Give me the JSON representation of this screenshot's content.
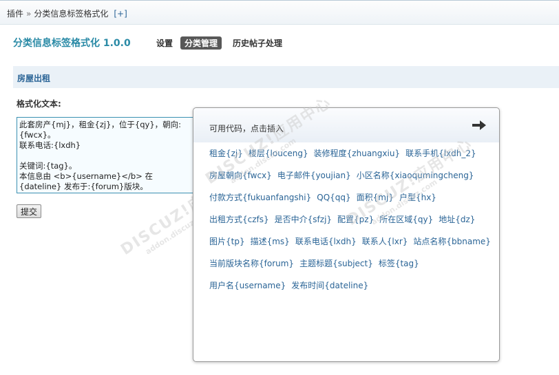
{
  "breadcrumb": {
    "root": "插件",
    "separator": "»",
    "current": "分类信息标签格式化",
    "add_label": "[+]"
  },
  "plugin_title": "分类信息标签格式化 1.0.0",
  "tabs": [
    {
      "label": "设置",
      "active": false
    },
    {
      "label": "分类管理",
      "active": true
    },
    {
      "label": "历史帖子处理",
      "active": false
    }
  ],
  "section_title": "房屋出租",
  "format_label": "格式化文本:",
  "format_text": "此套房产{mj}，租金{zj}，位于{qy}，朝向:{fwcx}。\n联系电话:{lxdh}\n\n关键词:{tag}。\n本信息由 <b>{username}</b> 在{dateline} 发布于:{forum}版块。",
  "submit_label": "提交",
  "popup": {
    "title": "可用代码，点击插入",
    "close_icon": "arrow-right-icon",
    "rows": [
      [
        "租金{zj}",
        "楼层{louceng}",
        "装修程度{zhuangxiu}",
        "联系手机{lxdh_2}"
      ],
      [
        "房屋朝向{fwcx}",
        "电子邮件{youjian}",
        "小区名称{xiaoqumingcheng}"
      ],
      [
        "付款方式{fukuanfangshi}",
        "QQ{qq}",
        "面积{mj}",
        "户型{hx}"
      ],
      [
        "出租方式{czfs}",
        "是否中介{sfzj}",
        "配置{pz}",
        "所在区域{qy}",
        "地址{dz}"
      ],
      [
        "图片{tp}",
        "描述{ms}",
        "联系电话{lxdh}",
        "联系人{lxr}",
        "站点名称{bbname}"
      ],
      [
        "当前版块名称{forum}",
        "主题标题{subject}",
        "标签{tag}"
      ],
      [
        "用户名{username}",
        "发布时间{dateline}"
      ]
    ]
  },
  "watermark": {
    "brand": "DISCUZ!应用中心",
    "url": "addon.discuz.com"
  },
  "colors": {
    "title": "#2a8aa6",
    "link": "#2a6496",
    "section_bg": "#eaf1f7",
    "active_tab_bg": "#585858"
  }
}
